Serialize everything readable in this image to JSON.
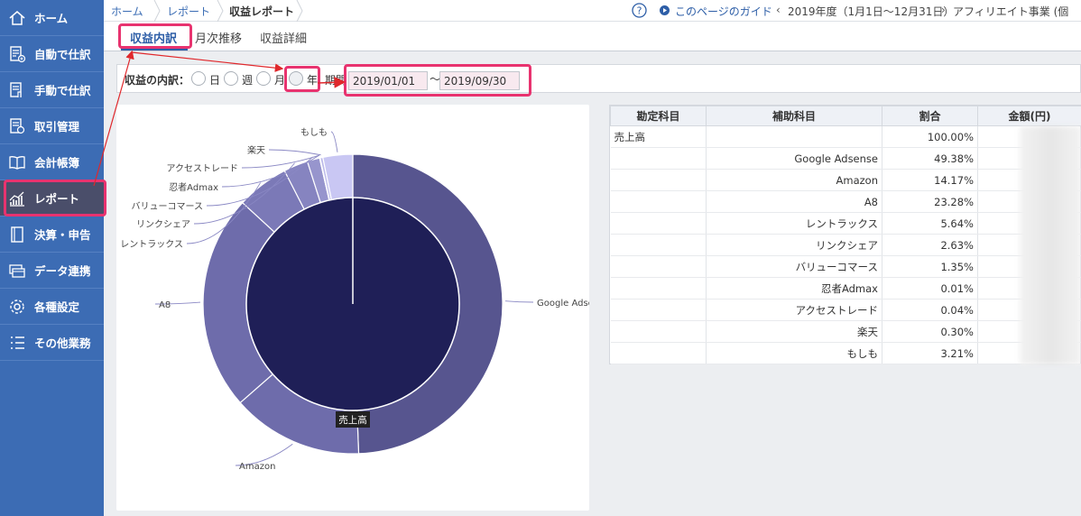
{
  "sidebar": {
    "items": [
      {
        "label": "ホーム",
        "icon": "home-icon"
      },
      {
        "label": "自動で仕訳",
        "icon": "auto-journal-icon"
      },
      {
        "label": "手動で仕訳",
        "icon": "manual-journal-icon"
      },
      {
        "label": "取引管理",
        "icon": "transaction-icon"
      },
      {
        "label": "会計帳簿",
        "icon": "ledger-book-icon"
      },
      {
        "label": "レポート",
        "icon": "report-chart-icon"
      },
      {
        "label": "決算・申告",
        "icon": "settlement-icon"
      },
      {
        "label": "データ連携",
        "icon": "data-link-icon"
      },
      {
        "label": "各種設定",
        "icon": "gear-icon"
      },
      {
        "label": "その他業務",
        "icon": "list-icon"
      }
    ]
  },
  "header": {
    "breadcrumb": [
      "ホーム",
      "レポート",
      "収益レポート"
    ],
    "guide_label": "このページのガイド",
    "fiscal_year": "2019年度（1月1日～12月31日）",
    "business": "アフィリエイト事業 (個人)"
  },
  "tabs": [
    "収益内訳",
    "月次推移",
    "収益詳細"
  ],
  "filter": {
    "label": "収益の内訳：",
    "options": [
      "日",
      "週",
      "月",
      "年"
    ],
    "period_label": "期間",
    "date_from": "2019/01/01",
    "tilde": "～",
    "date_to": "2019/09/30"
  },
  "chart": {
    "center_label": "売上高",
    "outer_labels": [
      "Google Adse",
      "Amazon",
      "A8",
      "レントラックス",
      "リンクシェア",
      "バリューコマース",
      "忍者Admax",
      "アクセストレード",
      "楽天",
      "もしも"
    ]
  },
  "chart_data": {
    "type": "pie",
    "center": "売上高",
    "series": [
      {
        "label": "Google Adsense",
        "value": 49.38
      },
      {
        "label": "Amazon",
        "value": 14.17
      },
      {
        "label": "A8",
        "value": 23.28
      },
      {
        "label": "レントラックス",
        "value": 5.64
      },
      {
        "label": "リンクシェア",
        "value": 2.63
      },
      {
        "label": "バリューコマース",
        "value": 1.35
      },
      {
        "label": "忍者Admax",
        "value": 0.01
      },
      {
        "label": "アクセストレード",
        "value": 0.04
      },
      {
        "label": "楽天",
        "value": 0.3
      },
      {
        "label": "もしも",
        "value": 3.21
      }
    ]
  },
  "table": {
    "headers": [
      "勘定科目",
      "補助科目",
      "割合",
      "金額(円)"
    ],
    "rows": [
      [
        "売上高",
        "",
        "100.00%",
        ""
      ],
      [
        "",
        "Google Adsense",
        "49.38%",
        ""
      ],
      [
        "",
        "Amazon",
        "14.17%",
        ""
      ],
      [
        "",
        "A8",
        "23.28%",
        ""
      ],
      [
        "",
        "レントラックス",
        "5.64%",
        ""
      ],
      [
        "",
        "リンクシェア",
        "2.63%",
        ""
      ],
      [
        "",
        "バリューコマース",
        "1.35%",
        ""
      ],
      [
        "",
        "忍者Admax",
        "0.01%",
        ""
      ],
      [
        "",
        "アクセストレード",
        "0.04%",
        ""
      ],
      [
        "",
        "楽天",
        "0.30%",
        ""
      ],
      [
        "",
        "もしも",
        "3.21%",
        ""
      ]
    ]
  },
  "colors": {
    "sidebar": "#3c6cb4",
    "accent": "#2d5ea7",
    "highlight": "#e8336f",
    "arrow": "#e0282c",
    "inner_pie": "#1f1f57"
  }
}
